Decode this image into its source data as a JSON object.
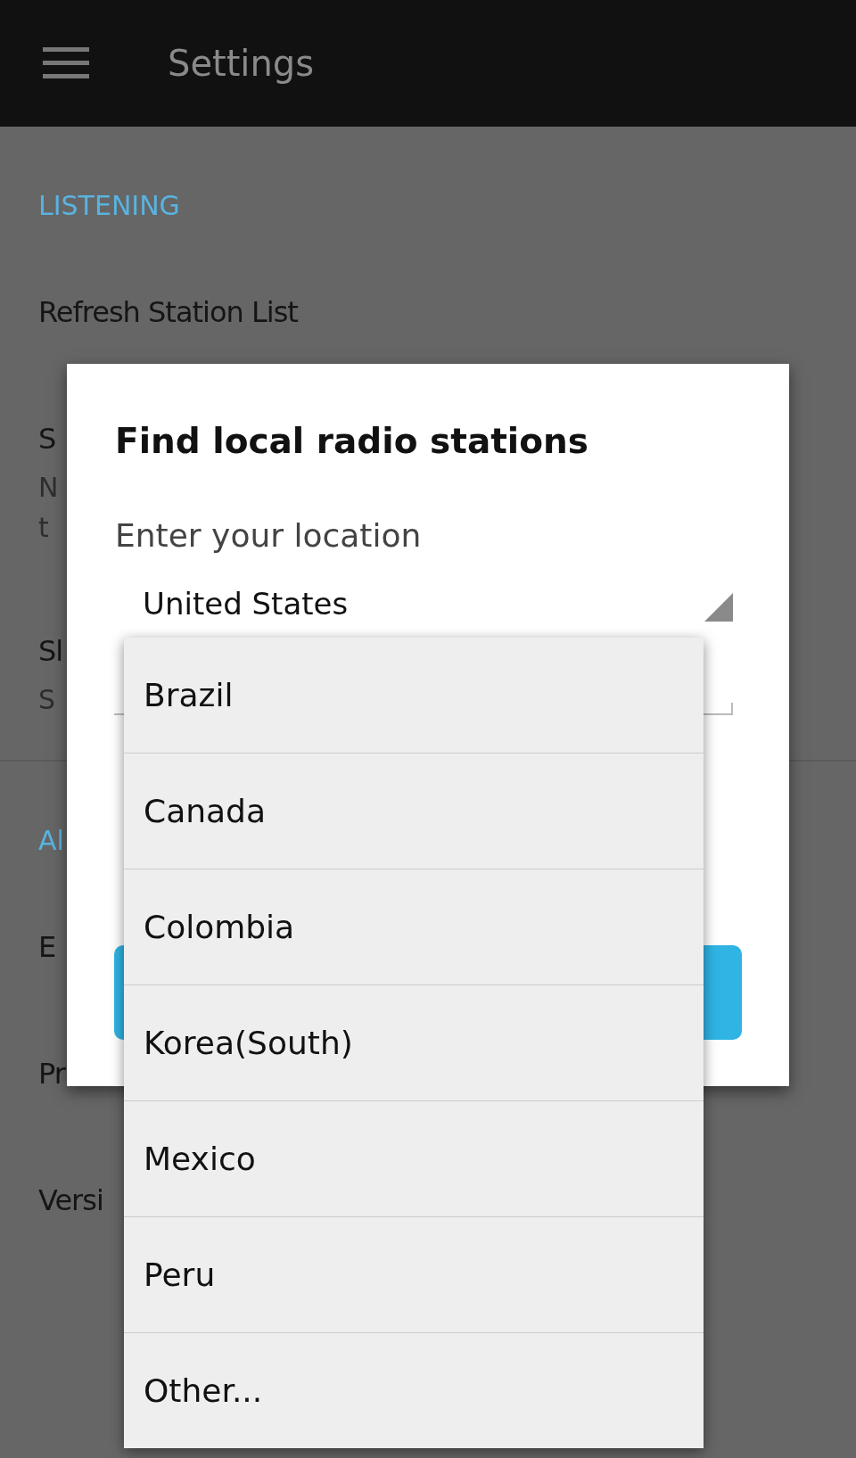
{
  "app_bar": {
    "title": "Settings"
  },
  "sections": [
    {
      "header": "LISTENING",
      "items": [
        {
          "title": "Refresh Station List"
        },
        {
          "title": "S",
          "subtitle_lines": [
            "N",
            "t"
          ]
        },
        {
          "title": "Sl",
          "subtitle_lines": [
            "S"
          ]
        }
      ]
    },
    {
      "header": "Al",
      "items": [
        {
          "title": "E"
        },
        {
          "title": "Pr"
        },
        {
          "title": "Versi"
        }
      ]
    }
  ],
  "dialog": {
    "title": "Find local radio stations",
    "label": "Enter your location",
    "spinner_value": "United States"
  },
  "dropdown": {
    "options": [
      "Brazil",
      "Canada",
      "Colombia",
      "Korea(South)",
      "Mexico",
      "Peru",
      "Other..."
    ]
  }
}
